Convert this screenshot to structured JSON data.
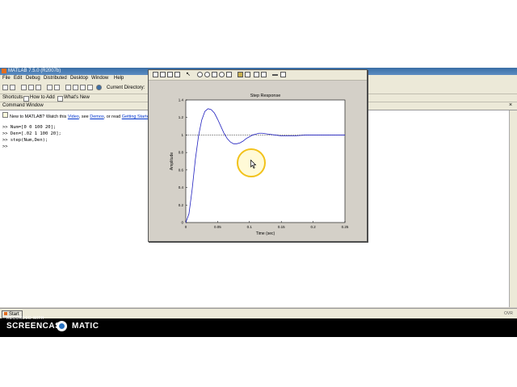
{
  "window": {
    "title": "MATLAB 7.5.0 (R2007b)"
  },
  "menu": [
    "File",
    "Edit",
    "Debug",
    "Distributed",
    "Desktop",
    "Window",
    "Help"
  ],
  "toolbar": {
    "current_directory_label": "Current Directory:"
  },
  "shortcuts": {
    "items": [
      "Shortcuts",
      "How to Add",
      "What's New"
    ]
  },
  "command_window": {
    "title": "Command Window",
    "notice": {
      "prefix": "New to MATLAB? Watch this",
      "video_link": "Video",
      "mid": ", see",
      "demos_link": "Demos",
      "suffix": ", or read",
      "getting_started_link": "Getting Started"
    },
    "lines": [
      ">> Num=[0 0 100 20];",
      ">> Den=[.02 1 100 20];",
      ">> step(Num,Den);",
      ">>"
    ]
  },
  "status": {
    "start": "Start",
    "ovr": "OVR"
  },
  "figure": {
    "chart_data": {
      "type": "line",
      "title": "Step Response",
      "xlabel": "Time (sec)",
      "ylabel": "Amplitude",
      "xlim": [
        0,
        0.25
      ],
      "ylim": [
        0,
        1.4
      ],
      "xticks": [
        "0",
        "0.05",
        "0.1",
        "0.15",
        "0.2",
        "0.25"
      ],
      "yticks": [
        "0",
        "0.2",
        "0.4",
        "0.6",
        "0.8",
        "1",
        "1.2",
        "1.4"
      ],
      "reference_value": 1,
      "series": [
        {
          "color": "#1f1fbf",
          "x": [
            0,
            0.005,
            0.01,
            0.015,
            0.02,
            0.025,
            0.03,
            0.035,
            0.04,
            0.045,
            0.05,
            0.055,
            0.06,
            0.065,
            0.07,
            0.075,
            0.08,
            0.085,
            0.09,
            0.095,
            0.1,
            0.105,
            0.11,
            0.115,
            0.12,
            0.13,
            0.14,
            0.15,
            0.16,
            0.17,
            0.18,
            0.19,
            0.2,
            0.21,
            0.22,
            0.23,
            0.24,
            0.25
          ],
          "y": [
            0,
            0.1,
            0.38,
            0.72,
            0.99,
            1.17,
            1.27,
            1.3,
            1.29,
            1.25,
            1.18,
            1.1,
            1.02,
            0.96,
            0.92,
            0.9,
            0.9,
            0.91,
            0.93,
            0.96,
            0.98,
            1.0,
            1.01,
            1.02,
            1.02,
            1.01,
            1.0,
            0.99,
            0.99,
            0.99,
            0.995,
            1.0,
            1.0,
            1.0,
            1.0,
            1.0,
            1.0,
            1.0
          ]
        }
      ]
    }
  },
  "watermark": {
    "small": "RECORDED WITH",
    "main_left": "SCREENCAST",
    "main_right": "MATIC"
  }
}
